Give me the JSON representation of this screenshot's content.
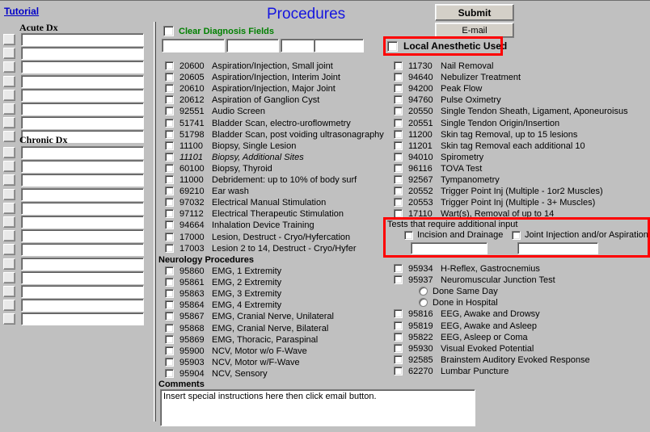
{
  "header": {
    "tutorial_link": "Tutorial",
    "title": "Procedures",
    "submit_label": "Submit",
    "email_label": "E-mail",
    "clear_diagnosis_label": "Clear Diagnosis Fields",
    "local_anesthetic_label": "Local Anesthetic Used",
    "dx_top_fields": [
      "",
      "",
      "",
      ""
    ],
    "accent_red": "#ff0000",
    "accent_blue": "#1515e0",
    "accent_green": "#008000",
    "link_blue": "#0000c8"
  },
  "dx_panel": {
    "acute_header": "Acute Dx",
    "chronic_header": "Chronic Dx",
    "acute_rows": [
      "",
      "",
      "",
      "",
      "",
      "",
      "",
      ""
    ],
    "chronic_rows": [
      "",
      "",
      "",
      "",
      "",
      "",
      "",
      "",
      "",
      "",
      "",
      "",
      ""
    ]
  },
  "procedures_left": [
    {
      "code": "20600",
      "desc": "Aspiration/Injection, Small joint",
      "italic": false
    },
    {
      "code": "20605",
      "desc": "Aspiration/Injection, Interim Joint",
      "italic": false
    },
    {
      "code": "20610",
      "desc": "Aspiration/Injection, Major Joint",
      "italic": false
    },
    {
      "code": "20612",
      "desc": "Aspiration of Ganglion Cyst",
      "italic": false
    },
    {
      "code": "92551",
      "desc": "Audio Screen",
      "italic": false
    },
    {
      "code": "51741",
      "desc": "Bladder Scan, electro-uroflowmetry",
      "italic": false
    },
    {
      "code": "51798",
      "desc": "Bladder Scan, post voiding ultrasonagraphy",
      "italic": false
    },
    {
      "code": "11100",
      "desc": "Biopsy, Single Lesion",
      "italic": false
    },
    {
      "code": "11101",
      "desc": "Biopsy, Additional Sites",
      "italic": true
    },
    {
      "code": "60100",
      "desc": "Biopsy, Thyroid",
      "italic": false
    },
    {
      "code": "11000",
      "desc": "Debridement: up to 10% of body surf",
      "italic": false
    },
    {
      "code": "69210",
      "desc": "Ear wash",
      "italic": false
    },
    {
      "code": "97032",
      "desc": "Electrical Manual Stimulation",
      "italic": false
    },
    {
      "code": "97112",
      "desc": "Electrical Therapeutic Stimulation",
      "italic": false
    },
    {
      "code": "94664",
      "desc": "Inhalation Device Training",
      "italic": false
    },
    {
      "code": "17000",
      "desc": "Lesion, Destruct - Cryo/Hyfercation",
      "italic": false
    },
    {
      "code": "17003",
      "desc": "Lesion 2 to 14, Destruct - Cryo/Hyfer",
      "italic": false
    }
  ],
  "neurology_header": "Neurology Procedures",
  "neurology_left": [
    {
      "code": "95860",
      "desc": "EMG, 1 Extremity"
    },
    {
      "code": "95861",
      "desc": "EMG, 2 Extremity"
    },
    {
      "code": "95863",
      "desc": "EMG, 3 Extremity"
    },
    {
      "code": "95864",
      "desc": "EMG, 4 Extremity"
    },
    {
      "code": "95867",
      "desc": "EMG, Cranial Nerve, Unilateral"
    },
    {
      "code": "95868",
      "desc": "EMG, Cranial Nerve, Bilateral"
    },
    {
      "code": "95869",
      "desc": "EMG, Thoracic, Paraspinal"
    },
    {
      "code": "95900",
      "desc": "NCV, Motor w/o F-Wave"
    },
    {
      "code": "95903",
      "desc": "NCV, Motor w/F-Wave"
    },
    {
      "code": "95904",
      "desc": "NCV, Sensory"
    }
  ],
  "procedures_right": [
    {
      "code": "11730",
      "desc": "Nail Removal"
    },
    {
      "code": "94640",
      "desc": "Nebulizer Treatment"
    },
    {
      "code": "94200",
      "desc": "Peak Flow"
    },
    {
      "code": "94760",
      "desc": "Pulse Oximetry"
    },
    {
      "code": "20550",
      "desc": "Single Tendon Sheath, Ligament, Aponeuroisus"
    },
    {
      "code": "20551",
      "desc": "Single Tendon Origin/Insertion"
    },
    {
      "code": "11200",
      "desc": "Skin tag Removal, up to 15 lesions"
    },
    {
      "code": "11201",
      "desc": "Skin tag Removal each additional 10"
    },
    {
      "code": "94010",
      "desc": "Spirometry"
    },
    {
      "code": "96116",
      "desc": "TOVA Test"
    },
    {
      "code": "92567",
      "desc": "Tympanometry"
    },
    {
      "code": "20552",
      "desc": "Trigger Point Inj (Multiple - 1or2 Muscles)"
    },
    {
      "code": "20553",
      "desc": "Trigger Point Inj (Multiple - 3+ Muscles)"
    },
    {
      "code": "17110",
      "desc": "Wart(s), Removal of up to 14"
    }
  ],
  "tests_section": {
    "title": "Tests that require additional input",
    "items": [
      {
        "label": "Incision and Drainage",
        "value": ""
      },
      {
        "label": "Joint Injection and/or Aspiration",
        "value": ""
      }
    ]
  },
  "neurology_right": [
    {
      "code": "95934",
      "desc": "H-Reflex, Gastrocnemius"
    },
    {
      "code": "95937",
      "desc": "Neuromuscular Junction Test"
    }
  ],
  "neuromuscular_options": [
    {
      "label": "Done Same Day"
    },
    {
      "label": "Done in Hospital"
    }
  ],
  "neurology_right_2": [
    {
      "code": "95816",
      "desc": "EEG, Awake and Drowsy"
    },
    {
      "code": "95819",
      "desc": "EEG, Awake and Asleep"
    },
    {
      "code": "95822",
      "desc": "EEG, Asleep or Coma"
    },
    {
      "code": "95930",
      "desc": "Visual Evoked Potential"
    },
    {
      "code": "92585",
      "desc": "Brainstem Auditory Evoked Response"
    },
    {
      "code": "62270",
      "desc": "Lumbar Puncture"
    }
  ],
  "comments": {
    "label": "Comments",
    "value": "Insert special instructions here then click email button."
  }
}
